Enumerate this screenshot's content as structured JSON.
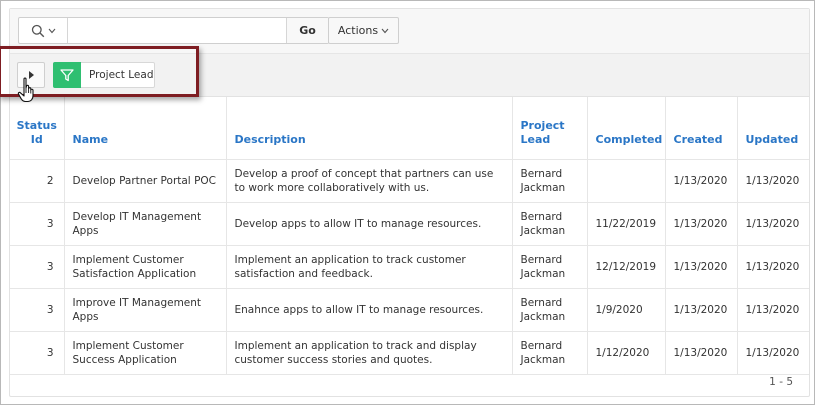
{
  "search": {
    "placeholder": "",
    "value": "",
    "go_label": "Go",
    "column_icon": "search-icon"
  },
  "actions": {
    "label": "Actions"
  },
  "filter": {
    "toggle_icon": "triangle-right-icon",
    "chip_icon": "funnel-icon",
    "chip_label": "Project Lead"
  },
  "colors": {
    "header_link": "#2a76c6",
    "filter_chip": "#2fbf71",
    "highlight_border": "#7e1d22"
  },
  "table": {
    "headers": {
      "status_id": "Status Id",
      "name": "Name",
      "description": "Description",
      "project_lead": "Project Lead",
      "completed": "Completed",
      "created": "Created",
      "updated": "Updated"
    },
    "rows": [
      {
        "status_id": "2",
        "name": "Develop Partner Portal POC",
        "description": "Develop a proof of concept that partners can use to work more collaboratively with us.",
        "project_lead": "Bernard Jackman",
        "completed": "",
        "created": "1/13/2020",
        "updated": "1/13/2020"
      },
      {
        "status_id": "3",
        "name": "Develop IT Management Apps",
        "description": "Develop apps to allow IT to manage resources.",
        "project_lead": "Bernard Jackman",
        "completed": "11/22/2019",
        "created": "1/13/2020",
        "updated": "1/13/2020"
      },
      {
        "status_id": "3",
        "name": "Implement Customer Satisfaction Application",
        "description": "Implement an application to track customer satisfaction and feedback.",
        "project_lead": "Bernard Jackman",
        "completed": "12/12/2019",
        "created": "1/13/2020",
        "updated": "1/13/2020"
      },
      {
        "status_id": "3",
        "name": "Improve IT Management Apps",
        "description": "Enahnce apps to allow IT to manage resources.",
        "project_lead": "Bernard Jackman",
        "completed": "1/9/2020",
        "created": "1/13/2020",
        "updated": "1/13/2020"
      },
      {
        "status_id": "3",
        "name": "Implement Customer Success Application",
        "description": "Implement an application to track and display customer success stories and quotes.",
        "project_lead": "Bernard Jackman",
        "completed": "1/12/2020",
        "created": "1/13/2020",
        "updated": "1/13/2020"
      }
    ]
  },
  "pagination": {
    "label": "1 - 5"
  }
}
